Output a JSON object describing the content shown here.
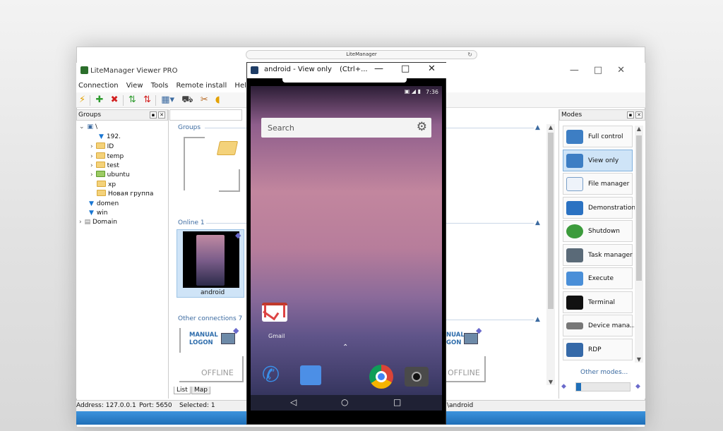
{
  "browser": {
    "tab_title": "LiteManager"
  },
  "window": {
    "title": "LiteManager Viewer PRO"
  },
  "menu": [
    "Connection",
    "View",
    "Tools",
    "Remote install",
    "Help"
  ],
  "groups_panel": {
    "title": "Groups",
    "root": "\\",
    "items": [
      "192.",
      "ID",
      "temp",
      "test",
      "ubuntu",
      "xp",
      "Новая группа",
      "domen",
      "win",
      "Domain"
    ]
  },
  "center": {
    "groups_section": "Groups",
    "online_section": "Online 1",
    "online_item": "android",
    "other_section": "Other connections 7",
    "manual_logon": "MANUAL\nLOGON",
    "offline": "OFFLINE",
    "manual_logon_right": "NUAL\nGON",
    "tabs": [
      "List",
      "Map"
    ]
  },
  "modes_panel": {
    "title": "Modes",
    "items": [
      "Full control",
      "View only",
      "File manager",
      "Demonstration",
      "Shutdown",
      "Task manager",
      "Execute",
      "Terminal",
      "Device mana...",
      "RDP"
    ],
    "more": "Other modes..."
  },
  "status": {
    "address": "Address: 127.0.0.1",
    "port": "Port: 5650",
    "selected": "Selected: 1",
    "right": "\\android"
  },
  "phone": {
    "title": "android  - View only",
    "shortcut": "(Ctrl+...",
    "time": "7:36",
    "search_placeholder": "Search",
    "gmail_label": "Gmail"
  },
  "colors": {
    "accent": "#1f6fb8",
    "selection": "#cfe4f7",
    "link": "#3b6aa0"
  }
}
